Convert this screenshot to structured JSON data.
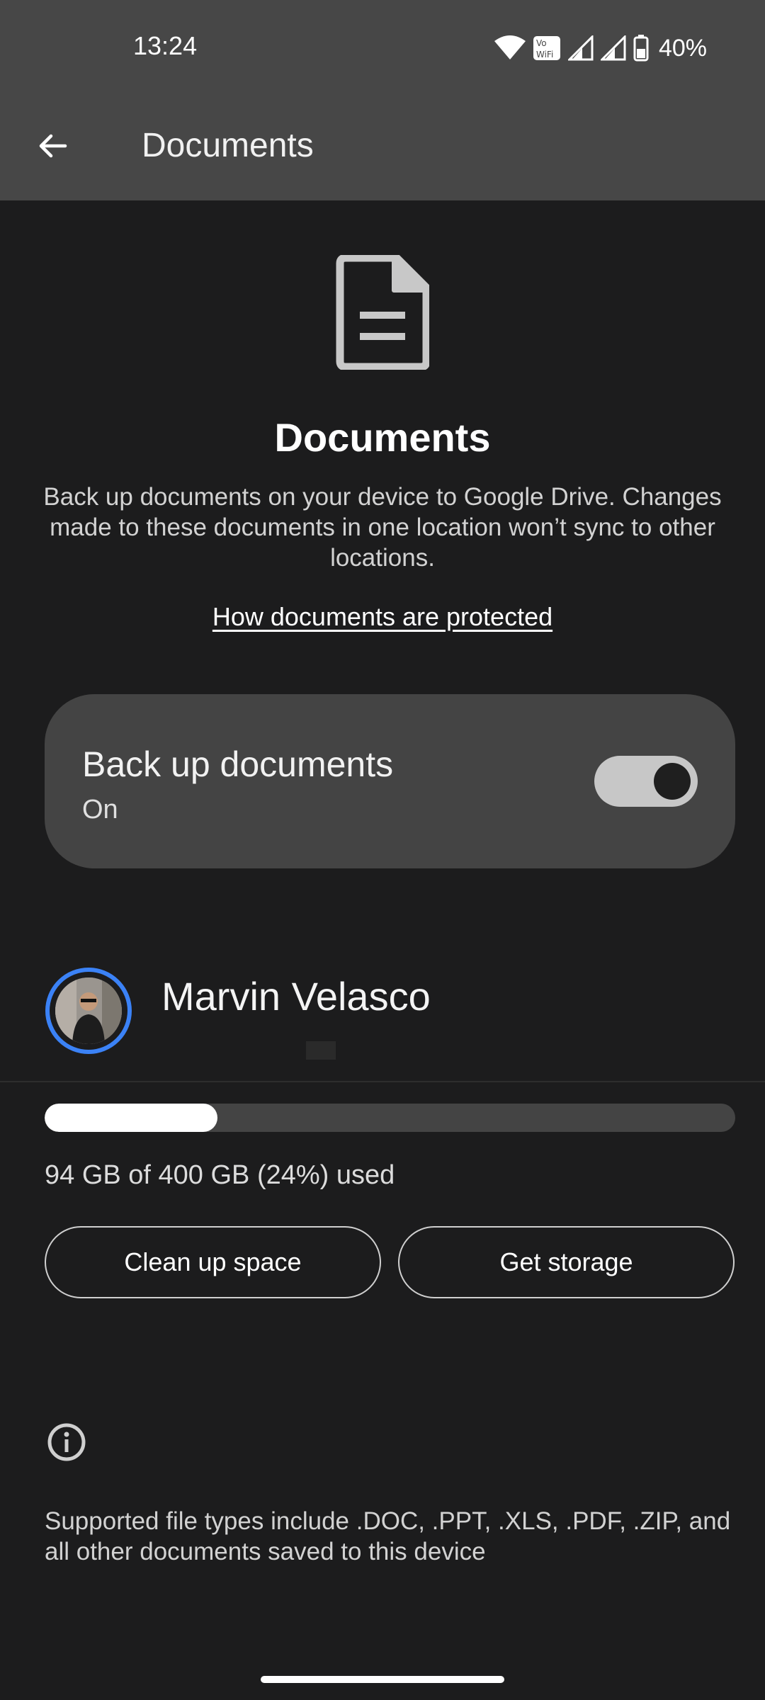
{
  "status_bar": {
    "time": "13:24",
    "wifi_label": "Vo WiFi",
    "battery": "40%",
    "icons": [
      "wifi-icon",
      "vowifi-icon",
      "signal-icon",
      "signal-icon",
      "battery-icon"
    ]
  },
  "app_bar": {
    "title": "Documents",
    "back_icon": "arrow-back-icon"
  },
  "hero": {
    "icon": "document-icon",
    "title": "Documents",
    "description": "Back up documents on your device to Google Drive. Changes made to these documents in one location won’t sync to other locations.",
    "link": "How documents are protected"
  },
  "backup_toggle": {
    "title": "Back up documents",
    "status": "On",
    "enabled": true
  },
  "account": {
    "name": "Marvin Velasco"
  },
  "storage": {
    "used_fraction": 0.24,
    "text": "94 GB of 400 GB (24%) used",
    "clean_label": "Clean up space",
    "get_label": "Get storage"
  },
  "info": {
    "icon": "info-icon",
    "text": "Supported file types include .DOC, .PPT, .XLS, .PDF, .ZIP, and all other documents saved to this device"
  },
  "colors": {
    "background": "#1c1c1d",
    "app_bar": "#474747",
    "card": "#444444",
    "accent_ring": "#3b82f6"
  }
}
